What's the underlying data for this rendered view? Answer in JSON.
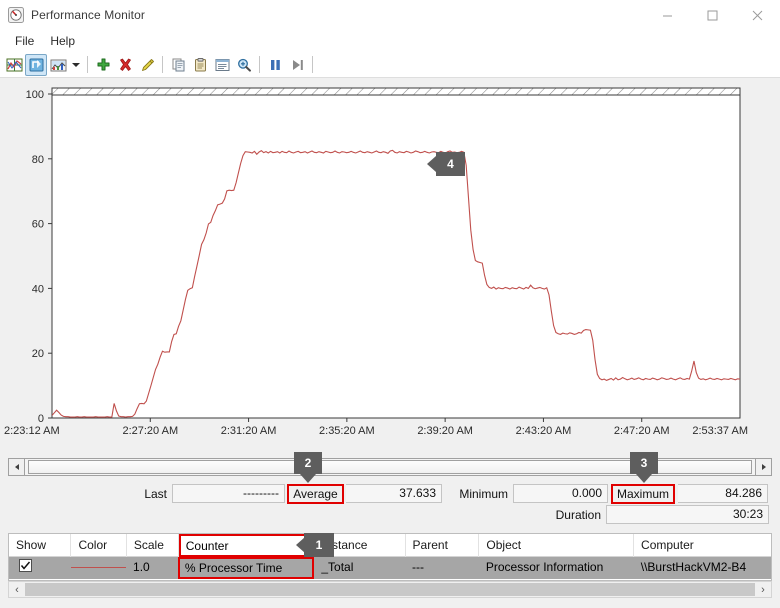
{
  "window": {
    "title": "Performance Monitor",
    "icon": "performance-monitor-icon",
    "minimize_label": "—",
    "maximize_label": "□",
    "close_label": "✕"
  },
  "menu": {
    "items": [
      {
        "label": "File"
      },
      {
        "label": "Help"
      }
    ]
  },
  "toolbar": {
    "buttons": [
      {
        "name": "view-current-activity-icon",
        "tooltip": "View Current Activity"
      },
      {
        "name": "view-log-data-icon",
        "tooltip": "View Log Data"
      },
      {
        "name": "change-graph-type-icon",
        "tooltip": "Change Graph Type"
      },
      {
        "name": "graph-type-dropdown-caret-icon",
        "tooltip": "Graph Type Menu"
      },
      {
        "name": "add-counter-icon",
        "tooltip": "Add"
      },
      {
        "name": "delete-counter-icon",
        "tooltip": "Delete"
      },
      {
        "name": "highlight-icon",
        "tooltip": "Highlight"
      },
      {
        "name": "copy-properties-icon",
        "tooltip": "Copy Properties"
      },
      {
        "name": "paste-counter-list-icon",
        "tooltip": "Paste Counter List"
      },
      {
        "name": "properties-icon",
        "tooltip": "Properties"
      },
      {
        "name": "zoom-to-icon",
        "tooltip": "Zoom To"
      },
      {
        "name": "freeze-display-icon",
        "tooltip": "Freeze Display"
      },
      {
        "name": "update-data-icon",
        "tooltip": "Update Data"
      }
    ]
  },
  "chart_data": {
    "type": "line",
    "title": "",
    "xlabel": "",
    "ylabel": "",
    "ylim": [
      0,
      100
    ],
    "yticks": [
      0,
      20,
      40,
      60,
      80,
      100
    ],
    "grid": false,
    "line_color": "#c0504d",
    "legend_position": "none",
    "xticklabels": [
      "2:23:12 AM",
      "2:27:20 AM",
      "2:31:20 AM",
      "2:35:20 AM",
      "2:39:20 AM",
      "2:43:20 AM",
      "2:47:20 AM",
      "2:53:37 AM"
    ],
    "series": [
      {
        "name": "% Processor Time",
        "values": [
          0.8,
          1.6,
          2.4,
          1.7,
          0.9,
          0.5,
          0.4,
          0.4,
          0.3,
          0.3,
          0.3,
          0.4,
          0.3,
          0.3,
          0.4,
          0.3,
          0.3,
          0.3,
          0.3,
          0.4,
          0.3,
          0.3,
          0.3,
          0.3,
          0.4,
          0.3,
          0.3,
          4.5,
          2.2,
          0.6,
          0.4,
          0.4,
          0.3,
          0.4,
          0.4,
          0.5,
          1.2,
          2.9,
          4.4,
          4.5,
          4.4,
          5.2,
          7.6,
          10.0,
          12.5,
          15.0,
          16.6,
          18.8,
          20.6,
          20.3,
          20.4,
          20.4,
          23.6,
          25.8,
          26.0,
          28.3,
          30.0,
          33.3,
          36.6,
          39.4,
          39.9,
          40.2,
          43.7,
          46.9,
          50.2,
          53.6,
          55.0,
          57.1,
          59.9,
          60.4,
          62.5,
          64.0,
          65.8,
          66.0,
          66.3,
          67.6,
          70.1,
          70.3,
          70.2,
          70.3,
          72.6,
          75.6,
          78.6,
          81.0,
          82.2,
          82.1,
          82.0,
          81.8,
          82.3,
          81.4,
          82.1,
          82.5,
          81.9,
          82.2,
          81.8,
          82.3,
          81.9,
          82.0,
          82.2,
          81.8,
          82.3,
          82.0,
          81.9,
          82.4,
          82.0,
          81.8,
          82.1,
          82.3,
          81.9,
          82.0,
          82.2,
          81.8,
          82.1,
          82.4,
          82.0,
          81.9,
          82.2,
          82.0,
          81.8,
          82.3,
          82.1,
          81.9,
          82.0,
          82.4,
          82.0,
          81.8,
          82.2,
          82.1,
          81.9,
          82.0,
          82.3,
          82.0,
          81.8,
          82.1,
          82.4,
          82.0,
          81.9,
          82.2,
          82.0,
          81.8,
          82.1,
          82.4,
          82.0,
          81.9,
          82.2,
          82.0,
          81.7,
          82.4,
          82.6,
          82.0,
          81.8,
          82.2,
          82.0,
          81.9,
          82.3,
          82.1,
          81.8,
          82.0,
          82.4,
          82.2,
          81.9,
          82.0,
          82.3,
          82.0,
          81.8,
          82.1,
          82.2,
          82.0,
          81.9,
          82.3,
          82.0,
          81.8,
          82.2,
          82.4,
          82.0,
          82.1,
          81.9,
          82.0,
          82.3,
          82.0,
          78.0,
          68.0,
          58.0,
          52.0,
          48.6,
          48.2,
          48.0,
          47.8,
          44.0,
          41.2,
          40.3,
          40.0,
          40.4,
          39.8,
          40.2,
          40.0,
          39.9,
          40.3,
          40.1,
          39.8,
          40.2,
          40.0,
          39.9,
          40.4,
          40.1,
          39.8,
          40.3,
          40.0,
          41.0,
          40.2,
          39.9,
          40.1,
          40.3,
          40.0,
          39.8,
          40.2,
          38.0,
          33.0,
          28.5,
          26.4,
          26.0,
          25.8,
          26.2,
          26.0,
          25.9,
          26.3,
          26.1,
          25.8,
          26.0,
          26.4,
          26.2,
          27.0,
          27.3,
          27.2,
          27.1,
          24.0,
          18.0,
          13.5,
          12.2,
          11.8,
          12.0,
          11.6,
          11.9,
          12.2,
          11.7,
          12.4,
          11.8,
          12.0,
          12.5,
          12.1,
          11.8,
          12.0,
          12.3,
          11.9,
          12.1,
          12.4,
          12.0,
          11.8,
          12.2,
          12.0,
          11.9,
          12.3,
          12.1,
          11.8,
          12.0,
          12.4,
          12.2,
          11.9,
          12.0,
          12.3,
          12.0,
          11.8,
          12.1,
          12.4,
          12.0,
          11.9,
          12.2,
          12.0,
          14.5,
          17.6,
          14.0,
          12.3,
          11.9,
          12.1,
          11.8,
          12.0,
          12.3,
          12.0,
          11.9,
          12.2,
          12.0,
          11.8,
          12.1,
          12.0,
          11.9,
          12.2,
          12.0,
          11.8,
          12.1,
          12.0
        ]
      }
    ]
  },
  "stats": {
    "last_label": "Last",
    "last_value": "---------",
    "average_label": "Average",
    "average_value": "37.633",
    "minimum_label": "Minimum",
    "minimum_value": "0.000",
    "maximum_label": "Maximum",
    "maximum_value": "84.286",
    "duration_label": "Duration",
    "duration_value": "30:23"
  },
  "legend_table": {
    "columns": [
      "Show",
      "Color",
      "Scale",
      "Counter",
      "Instance",
      "Parent",
      "Object",
      "Computer"
    ],
    "rows": [
      {
        "show": true,
        "color": "#c0504d",
        "scale": "1.0",
        "counter": "% Processor Time",
        "instance": "_Total",
        "parent": "---",
        "object": "Processor Information",
        "computer": "\\\\BurstHackVM2-B4"
      }
    ]
  },
  "annotations": {
    "badges": [
      {
        "id": "1",
        "label": "1",
        "target": "counter-column-header",
        "direction": "left"
      },
      {
        "id": "2",
        "label": "2",
        "target": "average-label",
        "direction": "down"
      },
      {
        "id": "3",
        "label": "3",
        "target": "maximum-label",
        "direction": "down"
      },
      {
        "id": "4",
        "label": "4",
        "target": "graph-plateau",
        "direction": "left"
      }
    ],
    "highlight_color": "#e00000"
  },
  "scrollbars": {
    "timeline_left_arrow": "◀",
    "timeline_right_arrow": "▶",
    "bottom_left_arrow": "‹",
    "bottom_right_arrow": "›"
  }
}
